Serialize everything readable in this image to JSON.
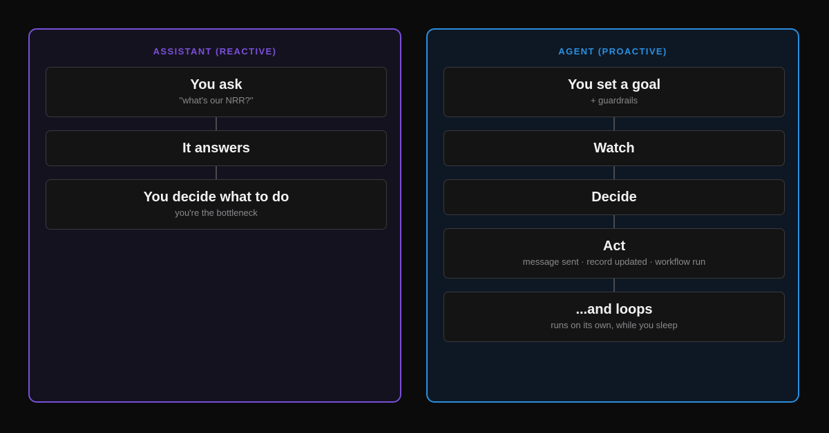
{
  "assistant": {
    "title": "ASSISTANT (REACTIVE)",
    "steps": [
      {
        "title": "You ask",
        "subtitle": "\"what's our NRR?\""
      },
      {
        "title": "It answers",
        "subtitle": ""
      },
      {
        "title": "You decide what to do",
        "subtitle": "you're the bottleneck"
      }
    ]
  },
  "agent": {
    "title": "AGENT (PROACTIVE)",
    "steps": [
      {
        "title": "You set a goal",
        "subtitle": "+ guardrails"
      },
      {
        "title": "Watch",
        "subtitle": ""
      },
      {
        "title": "Decide",
        "subtitle": ""
      },
      {
        "title": "Act",
        "subtitle": "message sent · record updated · workflow run"
      },
      {
        "title": "...and loops",
        "subtitle": "runs on its own, while you sleep"
      }
    ]
  },
  "colors": {
    "background": "#0b0b0c",
    "assistant_accent": "#7a4fd9",
    "agent_accent": "#2a8fe0",
    "card_background": "#141414",
    "card_border": "#3a3a3d"
  }
}
